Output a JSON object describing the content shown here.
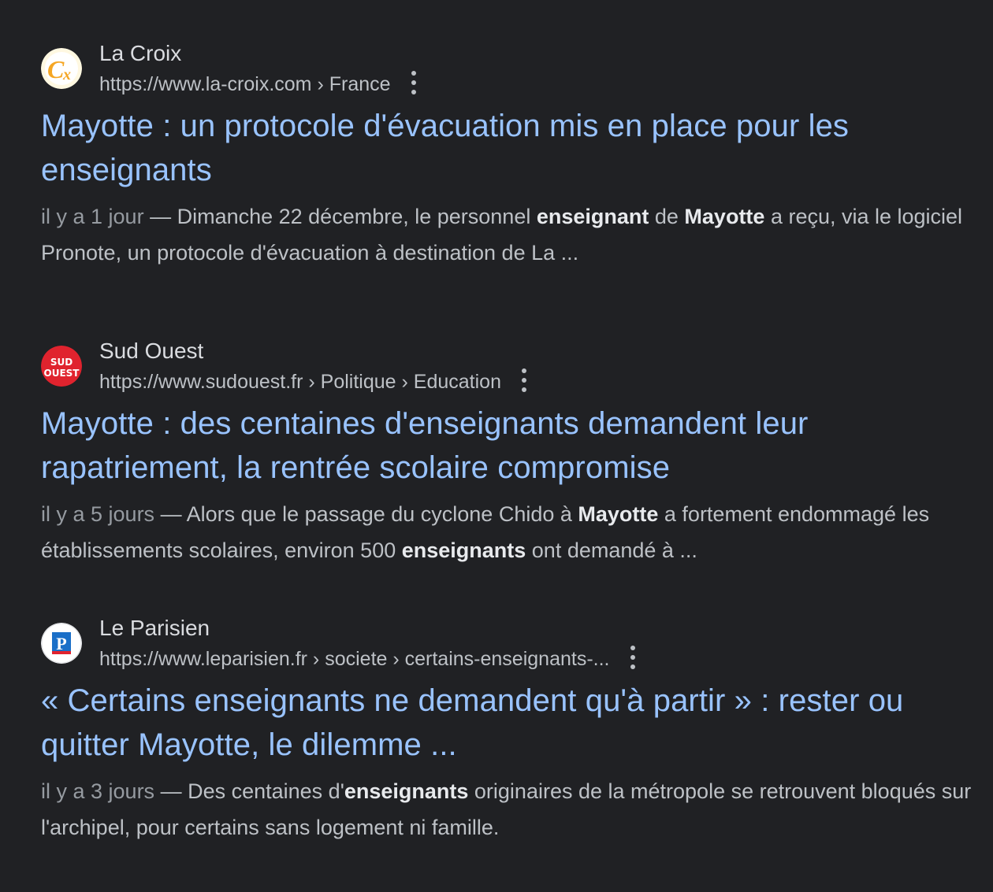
{
  "results": [
    {
      "site_name": "La Croix",
      "url": "https://www.la-croix.com › France",
      "favicon": "la-croix-logo",
      "title": "Mayotte : un protocole d'évacuation mis en place pour les enseignants",
      "date": "il y a 1 jour",
      "snippet": [
        {
          "text": "Dimanche 22 décembre, le personnel ",
          "bold": false
        },
        {
          "text": "enseignant",
          "bold": true
        },
        {
          "text": " de ",
          "bold": false
        },
        {
          "text": "Mayotte",
          "bold": true
        },
        {
          "text": " a reçu, via le logiciel Pronote, un protocole d'évacuation à destination de La ...",
          "bold": false
        }
      ]
    },
    {
      "site_name": "Sud Ouest",
      "url": "https://www.sudouest.fr › Politique › Education",
      "favicon": "sud-ouest-logo",
      "favicon_text": [
        "SUD",
        "OUEST"
      ],
      "title": "Mayotte : des centaines d'enseignants demandent leur rapatriement, la rentrée scolaire compromise",
      "date": "il y a 5 jours",
      "snippet": [
        {
          "text": "Alors que le passage du cyclone Chido à ",
          "bold": false
        },
        {
          "text": "Mayotte",
          "bold": true
        },
        {
          "text": " a fortement endommagé les établissements scolaires, environ 500 ",
          "bold": false
        },
        {
          "text": "enseignants",
          "bold": true
        },
        {
          "text": " ont demandé à ...",
          "bold": false
        }
      ]
    },
    {
      "site_name": "Le Parisien",
      "url": "https://www.leparisien.fr › societe › certains-enseignants-...",
      "favicon": "le-parisien-logo",
      "favicon_text": "P",
      "title": "« Certains enseignants ne demandent qu'à partir » : rester ou quitter Mayotte, le dilemme ...",
      "date": "il y a 3 jours",
      "snippet": [
        {
          "text": "Des centaines d'",
          "bold": false
        },
        {
          "text": "enseignants",
          "bold": true
        },
        {
          "text": " originaires de la métropole se retrouvent bloqués sur l'archipel, pour certains sans logement ni famille.",
          "bold": false
        }
      ]
    }
  ],
  "separator": " — ",
  "more_icon": "more-vert-icon",
  "colors": {
    "background": "#202124",
    "title": "#99c3ff",
    "text": "#bdc1c6",
    "bold": "#e8eaed"
  }
}
